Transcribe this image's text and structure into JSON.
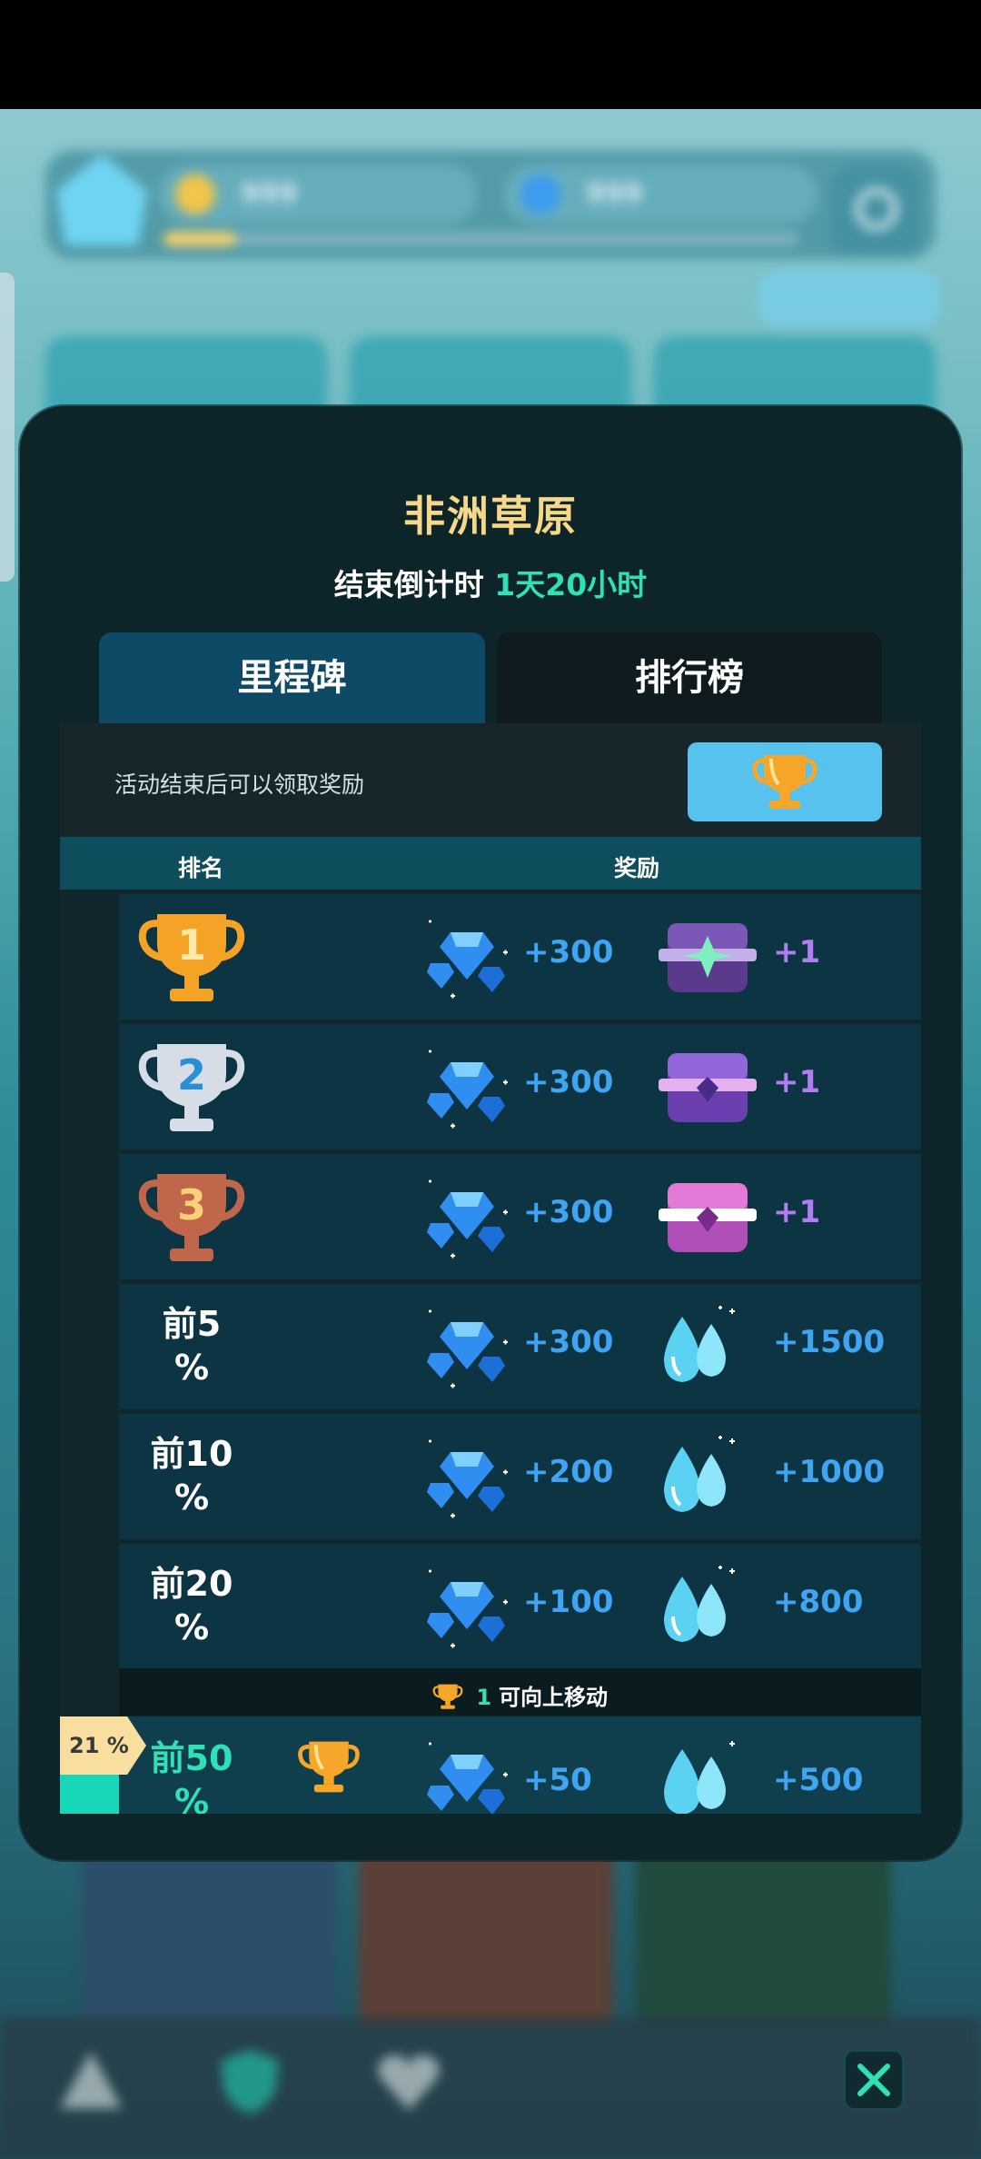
{
  "background": {
    "resource_a": "999",
    "resource_b": "999"
  },
  "panel": {
    "title": "非洲草原",
    "countdown_label": "结束倒计时",
    "countdown_value": "1天20小时",
    "tabs": [
      {
        "label": "里程碑",
        "active": false
      },
      {
        "label": "排行榜",
        "active": true
      }
    ],
    "notice": "活动结束后可以领取奖励",
    "header": {
      "rank": "排名",
      "reward": "奖励"
    },
    "rows": [
      {
        "rank": "1",
        "trophy": "gold-trophy-icon",
        "gem_amount": "+300",
        "item": "purple-star-chest-icon",
        "item_amount": "+1"
      },
      {
        "rank": "2",
        "trophy": "silver-trophy-icon",
        "gem_amount": "+300",
        "item": "purple-chest-icon",
        "item_amount": "+1"
      },
      {
        "rank": "3",
        "trophy": "bronze-trophy-icon",
        "gem_amount": "+300",
        "item": "pink-chest-icon",
        "item_amount": "+1"
      },
      {
        "rank": "前5\n%",
        "gem_amount": "+300",
        "item": "water-drop-icon",
        "item_amount": "+1500"
      },
      {
        "rank": "前10\n%",
        "gem_amount": "+200",
        "item": "water-drop-icon",
        "item_amount": "+1000"
      },
      {
        "rank": "前20\n%",
        "gem_amount": "+100",
        "item": "water-drop-icon",
        "item_amount": "+800"
      }
    ],
    "move_bar": {
      "count": "1",
      "text": "可向上移动"
    },
    "my_row": {
      "percent": "21 %",
      "rank": "前50\n%",
      "gem_amount": "+50",
      "item_amount": "+500"
    }
  },
  "colors": {
    "title": "#f7d88a",
    "accent_green": "#2fe0b8",
    "gem_blue": "#3fa4f2",
    "item_purple": "#b07ef0",
    "panel_bg": "#0d2429"
  }
}
